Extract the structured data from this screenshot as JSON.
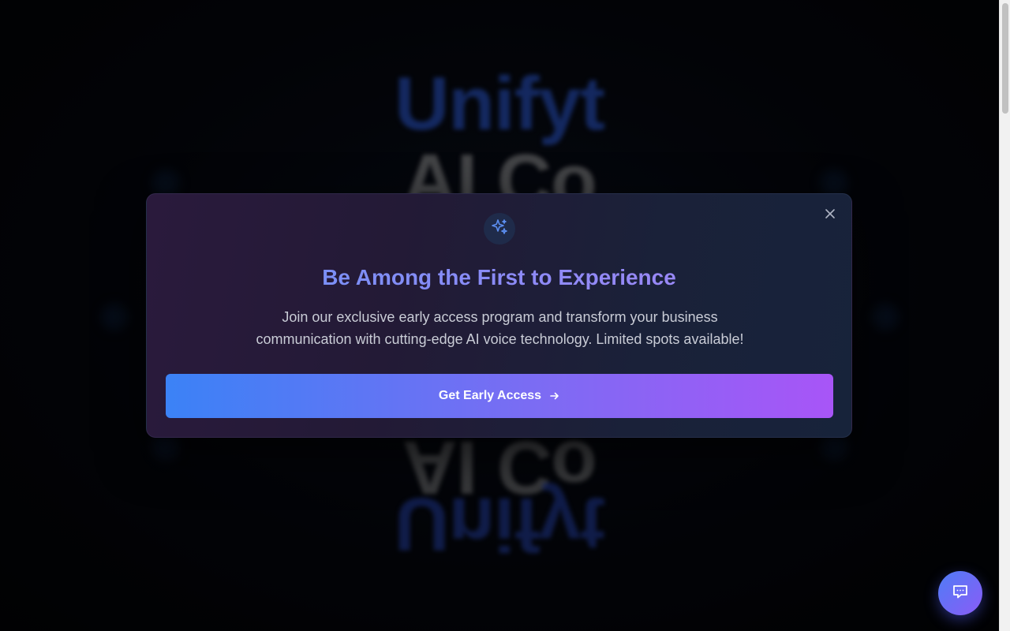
{
  "background": {
    "brand_text": "Unifyt",
    "tagline_text": "AI Co"
  },
  "modal": {
    "icon": "sparkles-icon",
    "title": "Be Among the First to Experience",
    "description": "Join our exclusive early access program and transform your business communication with cutting-edge AI voice technology. Limited spots available!",
    "cta_label": "Get Early Access",
    "cta_icon": "arrow-right-icon",
    "close_icon": "close-icon"
  },
  "chat": {
    "icon": "chat-icon"
  },
  "colors": {
    "accent_blue": "#3b82f6",
    "accent_purple": "#a855f7",
    "modal_bg": "#231a36"
  }
}
